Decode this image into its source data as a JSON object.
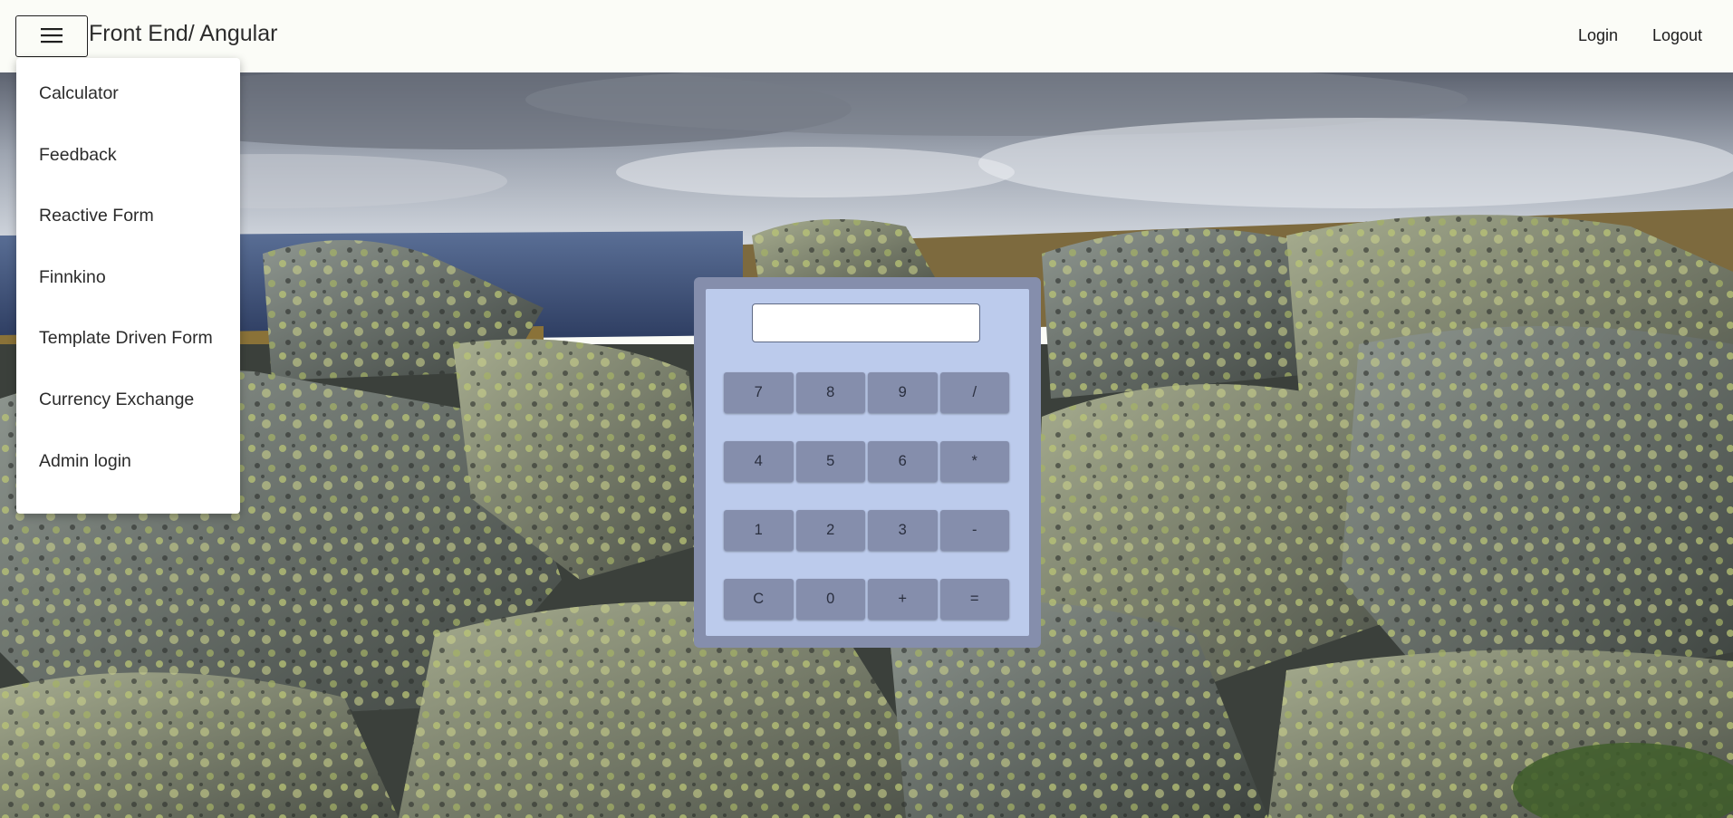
{
  "app": {
    "brand": "Front End/ Angular"
  },
  "header": {
    "menu_icon": "hamburger-menu-icon",
    "login_label": "Login",
    "logout_label": "Logout"
  },
  "dropdown": {
    "items": [
      {
        "label": "Calculator"
      },
      {
        "label": "Feedback"
      },
      {
        "label": "Reactive Form"
      },
      {
        "label": "Finnkino"
      },
      {
        "label": "Template Driven Form"
      },
      {
        "label": "Currency Exchange"
      },
      {
        "label": "Admin login"
      }
    ]
  },
  "calculator": {
    "display_value": "",
    "rows": [
      [
        "7",
        "8",
        "9",
        "/"
      ],
      [
        "4",
        "5",
        "6",
        "*"
      ],
      [
        "1",
        "2",
        "3",
        "-"
      ],
      [
        "C",
        "0",
        "+",
        "="
      ]
    ]
  },
  "background": {
    "description_icon": "rocky-fell-landscape-photo"
  },
  "colors": {
    "topbar_bg": "#fbfcf7",
    "calc_frame": "#858eac",
    "calc_panel": "#bccbec",
    "calc_key": "#858eac"
  }
}
